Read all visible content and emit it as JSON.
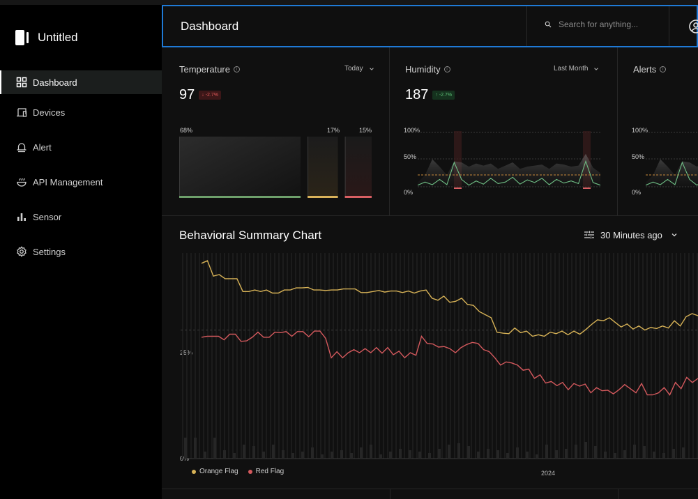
{
  "app": {
    "name": "Untitled"
  },
  "sidebar": {
    "items": [
      {
        "label": "Dashboard",
        "icon": "grid-icon",
        "active": true
      },
      {
        "label": "Devices",
        "icon": "devices-icon",
        "active": false
      },
      {
        "label": "Alert",
        "icon": "bell-icon",
        "active": false
      },
      {
        "label": "API Management",
        "icon": "api-icon",
        "active": false
      },
      {
        "label": "Sensor",
        "icon": "bar-chart-icon",
        "active": false
      },
      {
        "label": "Settings",
        "icon": "gear-icon",
        "active": false
      }
    ]
  },
  "header": {
    "title": "Dashboard",
    "search_placeholder": "Search for anything...",
    "accent": "#1f7ad6"
  },
  "cards": [
    {
      "title": "Temperature",
      "period": "Today",
      "value": "97",
      "delta": "-2.7%",
      "delta_direction": "down",
      "bars": [
        {
          "label": "68%",
          "value": 68,
          "color": "#6ea06b"
        },
        {
          "label": "17%",
          "value": 17,
          "color": "#d9b25a"
        },
        {
          "label": "15%",
          "value": 15,
          "color": "#d95f63"
        }
      ]
    },
    {
      "title": "Humidity",
      "period": "Last Month",
      "value": "187",
      "delta": "-2.7%",
      "delta_direction": "up",
      "yticks": [
        "100%",
        "50%",
        "0%"
      ]
    },
    {
      "title": "Alerts",
      "yticks": [
        "100%",
        "50%",
        "0%"
      ]
    }
  ],
  "behavioral": {
    "title": "Behavioral Summary Chart",
    "time_range": "30 Minutes ago",
    "x_label": "2024",
    "y_ticks": [
      "25%",
      "0%"
    ],
    "legend": [
      {
        "name": "Orange Flag",
        "color": "#d8b357"
      },
      {
        "name": "Red Flag",
        "color": "#d4595d"
      }
    ]
  },
  "chart_data": [
    {
      "type": "bar",
      "title": "Temperature",
      "categories": [
        "68%",
        "17%",
        "15%"
      ],
      "values": [
        68,
        17,
        15
      ],
      "ylim": [
        0,
        100
      ]
    },
    {
      "type": "area",
      "title": "Humidity",
      "ylim": [
        0,
        100
      ],
      "yticks": [
        "0%",
        "50%",
        "100%"
      ],
      "series": [
        {
          "values": [
            8,
            22,
            52,
            38,
            22,
            48,
            46,
            38,
            44,
            40,
            44,
            34,
            40,
            46,
            34,
            38,
            40,
            42,
            34,
            44,
            42,
            38,
            40,
            62,
            36,
            26
          ]
        },
        {
          "values": [
            3,
            9,
            4,
            14,
            4,
            46,
            14,
            3,
            11,
            5,
            16,
            6,
            9,
            18,
            5,
            13,
            8,
            16,
            4,
            14,
            7,
            11,
            6,
            48,
            8,
            3
          ]
        }
      ]
    },
    {
      "type": "line",
      "title": "Behavioral Summary Chart",
      "ylim": [
        0,
        40
      ],
      "yticks": [
        "0%",
        "25%"
      ],
      "series": [
        {
          "name": "Orange Flag",
          "values": [
            38,
            38.5,
            35.5,
            35.8,
            35,
            35,
            35,
            32.5,
            32.5,
            32.8,
            32.5,
            32.8,
            32.2,
            32.2,
            32.8,
            32.8,
            33.2,
            33.2,
            33.3,
            32.8,
            32.8,
            32.7,
            32.8,
            32.8,
            33,
            33,
            33,
            32.3,
            32.3,
            32.5,
            32.7,
            32.4,
            32.6,
            32.6,
            32.3,
            32.6,
            32.2,
            32.6,
            32.8,
            31.2,
            30.8,
            31.6,
            30.4,
            30.6,
            31.2,
            30,
            29.8,
            28.6,
            28,
            27.4,
            24.6,
            24.4,
            24.3,
            25.4,
            24.5,
            24.8,
            23.8,
            24.1,
            23.8,
            24.6,
            24.3,
            24.8,
            24.1,
            24.8,
            24.2,
            25.1,
            26.1,
            27,
            26.8,
            27.4,
            26.5,
            25.6,
            26.2,
            25.2,
            25.8,
            25,
            25.5,
            25.3,
            25.8,
            25.4,
            26.8,
            25.8,
            27.6,
            28.2,
            27.8
          ]
        },
        {
          "name": "Red Flag",
          "values": [
            23.6,
            23.8,
            23.8,
            23.8,
            23.1,
            24.2,
            24.2,
            22.8,
            22.9,
            23.6,
            24.6,
            23.6,
            23.6,
            24.6,
            24.5,
            24.7,
            23.8,
            24.7,
            24.7,
            23.7,
            24.8,
            24.8,
            23.4,
            19.6,
            20.8,
            19.6,
            20.6,
            21.2,
            20.6,
            21.4,
            20.6,
            21.6,
            20.5,
            21.6,
            20.2,
            20.9,
            19.6,
            20.6,
            20.1,
            23.8,
            22.4,
            22.3,
            21.7,
            21.8,
            21.4,
            20.6,
            21.6,
            22.2,
            22.6,
            22.4,
            21.2,
            20.8,
            19.6,
            18.2,
            18.8,
            18.6,
            18.2,
            17.2,
            17.4,
            15.6,
            16.3,
            14.7,
            15,
            14.2,
            14.8,
            13.4,
            14.6,
            14.1,
            14.5,
            12.8,
            13.8,
            13.2,
            13.3,
            12.6,
            13.4,
            14.4,
            13.6,
            12.8,
            14.6,
            12.4,
            12.4,
            12.8,
            13.8,
            12.4,
            14.8,
            13.6,
            15.8,
            14.8,
            15.6
          ]
        }
      ]
    }
  ]
}
